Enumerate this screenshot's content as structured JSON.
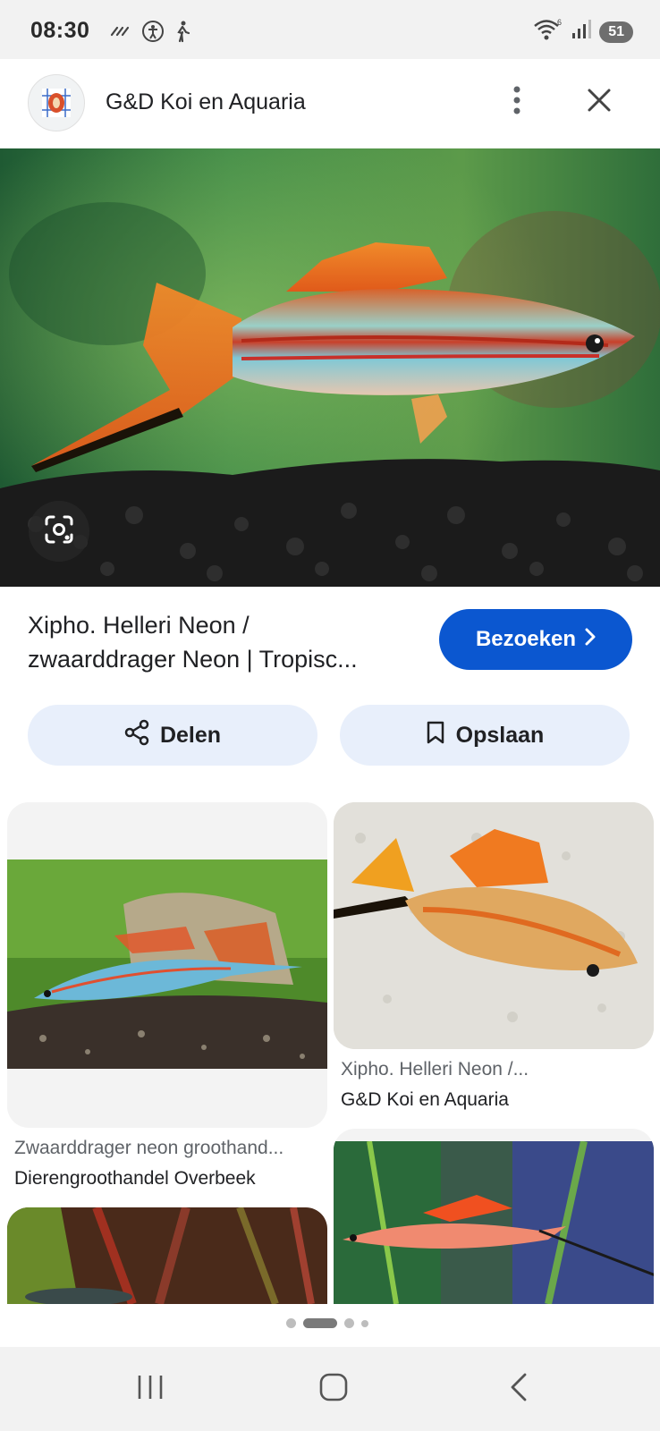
{
  "status_bar": {
    "time": "08:30",
    "battery": "51",
    "icons": [
      "alarm-icon",
      "accessibility-icon",
      "walk-icon",
      "wifi-icon",
      "signal-icon"
    ]
  },
  "header": {
    "site_name": "G&D Koi en Aquaria",
    "menu_icon": "more-vert-icon",
    "close_icon": "close-icon"
  },
  "result": {
    "title_line1": "Xipho. Helleri Neon /",
    "title_line2": "zwaarddrager Neon | Tropisc...",
    "visit_label": "Bezoeken"
  },
  "actions": {
    "share_label": "Delen",
    "save_label": "Opslaan"
  },
  "related": [
    {
      "title": "Zwaarddrager neon groothand...",
      "source": "Dierengroothandel Overbeek"
    },
    {
      "title": "Xipho. Helleri Neon /...",
      "source": "G&D Koi en Aquaria"
    }
  ],
  "pagination": {
    "pages": 4,
    "active_index": 1
  },
  "colors": {
    "accent": "#0b57d0",
    "chip_bg": "#e8effb"
  }
}
